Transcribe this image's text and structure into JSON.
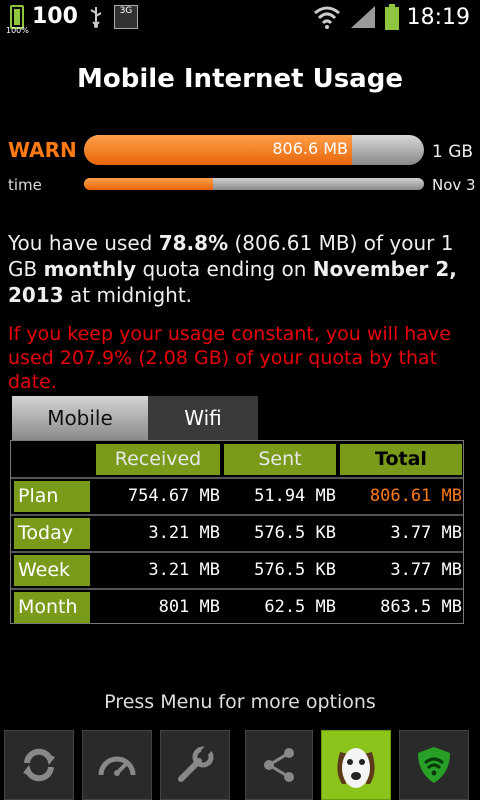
{
  "status_bar": {
    "battery_level": "100",
    "battery_small": "100%",
    "network_badge": "3G",
    "clock": "18:19",
    "icons": [
      "battery-icon",
      "usb-icon",
      "3g-icon",
      "wifi-icon",
      "signal-icon",
      "battery-icon"
    ]
  },
  "title": "Mobile Internet Usage",
  "usage": {
    "status": "WARN",
    "fill_fraction": 0.788,
    "amount": "806.6 MB",
    "limit": "1 GB",
    "time_label": "time",
    "time_fraction": 0.38,
    "end_date": "Nov 3"
  },
  "summary": {
    "part1": "You have used ",
    "pct": "78.8%",
    "part2": " (806.61 MB) of your 1 GB ",
    "period": "monthly",
    "part3": " quota ending on ",
    "date": "November 2, 2013",
    "part4": " at midnight."
  },
  "projection": "If you keep your usage constant, you will have used 207.9% (2.08 GB) of your quota by that date.",
  "tabs": [
    {
      "label": "Mobile",
      "active": true
    },
    {
      "label": "Wifi",
      "active": false
    }
  ],
  "table": {
    "headers": [
      "Received",
      "Sent",
      "Total"
    ],
    "rows": [
      {
        "label": "Plan",
        "received": "754.67 MB",
        "sent": "51.94 MB",
        "total": "806.61 MB"
      },
      {
        "label": "Today",
        "received": "3.21 MB",
        "sent": "576.5 KB",
        "total": "3.77 MB"
      },
      {
        "label": "Week",
        "received": "3.21 MB",
        "sent": "576.5 KB",
        "total": "3.77 MB"
      },
      {
        "label": "Month",
        "received": "801 MB",
        "sent": "62.5 MB",
        "total": "863.5 MB"
      }
    ]
  },
  "hint": "Press Menu for more options",
  "toolbar": [
    "refresh-icon",
    "speedometer-icon",
    "wrench-icon",
    "share-icon",
    "dog-logo-icon",
    "shield-icon"
  ],
  "colors": {
    "accent": "#ff7a14",
    "green": "#7a9a1a",
    "red": "#e8000a"
  }
}
